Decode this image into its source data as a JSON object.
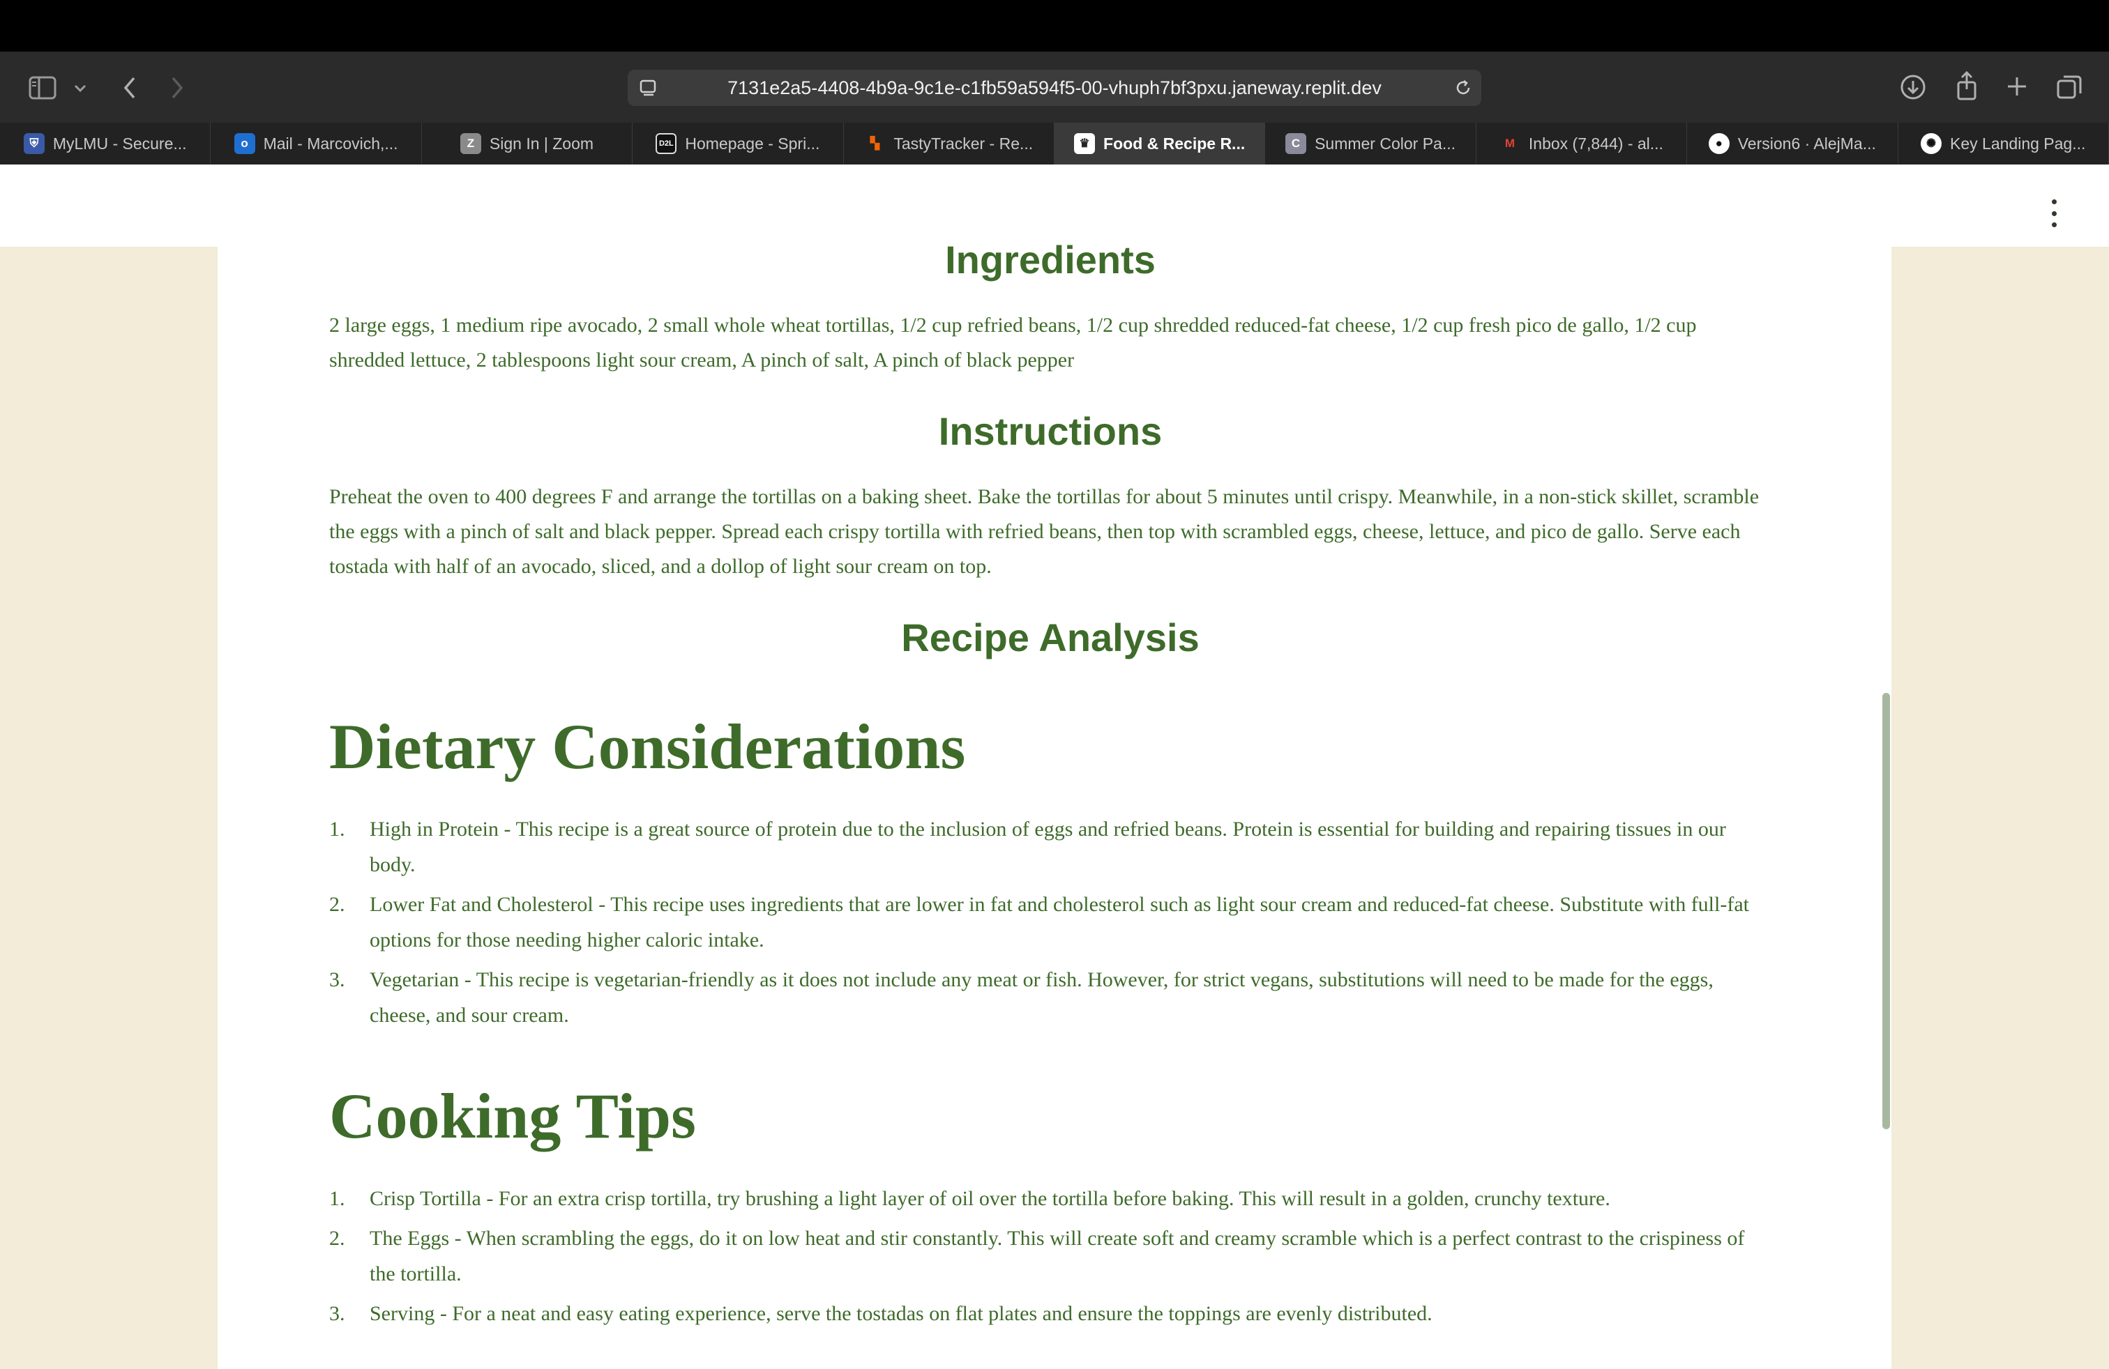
{
  "browser": {
    "url": "7131e2a5-4408-4b9a-9c1e-c1fb59a594f5-00-vhuph7bf3pxu.janeway.replit.dev",
    "tabs": [
      {
        "label": "MyLMU - Secure...",
        "icon": "shield-icon",
        "color": "#3a5aa8",
        "glyph": "⛨"
      },
      {
        "label": "Mail - Marcovich,...",
        "icon": "outlook-icon",
        "color": "#1f6fd1",
        "glyph": "o"
      },
      {
        "label": "Sign In | Zoom",
        "icon": "zoom-icon",
        "color": "#8a8a8a",
        "glyph": "Z"
      },
      {
        "label": "Homepage - Spri...",
        "icon": "d2l-icon",
        "color": "#111111",
        "glyph": "D2L"
      },
      {
        "label": "TastyTracker - Re...",
        "icon": "replit-icon",
        "color": "#2a2a2a",
        "glyph": "▚"
      },
      {
        "label": "Food & Recipe R...",
        "icon": "crown-icon",
        "color": "#ffffff",
        "glyph": "♛",
        "active": true
      },
      {
        "label": "Summer Color Pa...",
        "icon": "coolors-icon",
        "color": "#8a8a9a",
        "glyph": "C"
      },
      {
        "label": "Inbox (7,844) - al...",
        "icon": "gmail-icon",
        "color": "#2a2a2a",
        "glyph": "M"
      },
      {
        "label": "Version6 · AlejMa...",
        "icon": "github-icon",
        "color": "#2a2a2a",
        "glyph": "●"
      },
      {
        "label": "Key Landing Pag...",
        "icon": "openai-icon",
        "color": "#2a2a2a",
        "glyph": "✺"
      }
    ]
  },
  "recipe": {
    "ingredients_title": "Ingredients",
    "ingredients": "2 large eggs, 1 medium ripe avocado, 2 small whole wheat tortillas, 1/2 cup refried beans, 1/2 cup shredded reduced-fat cheese, 1/2 cup fresh pico de gallo, 1/2 cup shredded lettuce, 2 tablespoons light sour cream, A pinch of salt, A pinch of black pepper",
    "instructions_title": "Instructions",
    "instructions": "Preheat the oven to 400 degrees F and arrange the tortillas on a baking sheet. Bake the tortillas for about 5 minutes until crispy. Meanwhile, in a non-stick skillet, scramble the eggs with a pinch of salt and black pepper. Spread each crispy tortilla with refried beans, then top with scrambled eggs, cheese, lettuce, and pico de gallo. Serve each tostada with half of an avocado, sliced, and a dollop of light sour cream on top.",
    "analysis_title": "Recipe Analysis",
    "dietary_title": "Dietary Considerations",
    "dietary": [
      {
        "num": "1.",
        "text": "High in Protein - This recipe is a great source of protein due to the inclusion of eggs and refried beans. Protein is essential for building and repairing tissues in our body."
      },
      {
        "num": "2.",
        "text": "Lower Fat and Cholesterol - This recipe uses ingredients that are lower in fat and cholesterol such as light sour cream and reduced-fat cheese. Substitute with full-fat options for those needing higher caloric intake."
      },
      {
        "num": "3.",
        "text": "Vegetarian - This recipe is vegetarian-friendly as it does not include any meat or fish. However, for strict vegans, substitutions will need to be made for the eggs, cheese, and sour cream."
      }
    ],
    "tips_title": "Cooking Tips",
    "tips": [
      {
        "num": "1.",
        "text": "Crisp Tortilla - For an extra crisp tortilla, try brushing a light layer of oil over the tortilla before baking. This will result in a golden, crunchy texture."
      },
      {
        "num": "2.",
        "text": "The Eggs - When scrambling the eggs, do it on low heat and stir constantly. This will create soft and creamy scramble which is a perfect contrast to the crispiness of the tortilla."
      },
      {
        "num": "3.",
        "text": "Serving - For a neat and easy eating experience, serve the tostadas on flat plates and ensure the toppings are evenly distributed."
      }
    ]
  },
  "colors": {
    "accent_green": "#3e6b2a",
    "page_background": "#f2ecd8"
  }
}
